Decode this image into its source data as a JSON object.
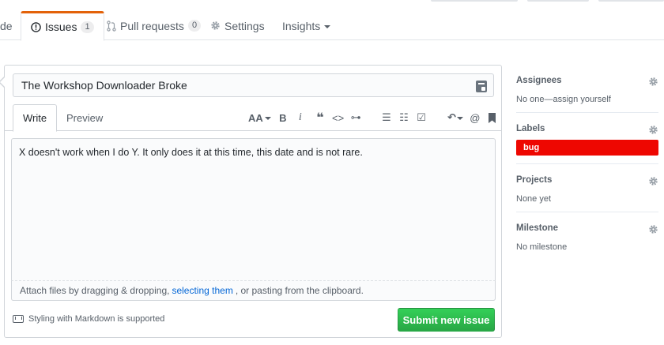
{
  "nav": {
    "code_fragment": "de",
    "issues_label": "Issues",
    "issues_count": "1",
    "pulls_label": "Pull requests",
    "pulls_count": "0",
    "settings_label": "Settings",
    "insights_label": "Insights"
  },
  "form": {
    "title_value": "The Workshop Downloader Broke",
    "write_tab": "Write",
    "preview_tab": "Preview",
    "toolbar": {
      "header": "AA",
      "bold": "B",
      "italic": "i",
      "quote": "❝",
      "code": "<>",
      "link": "⊶",
      "ul": "☰",
      "ol": "☷",
      "tasks": "☑",
      "reply": "↶",
      "mention": "@",
      "bookmark": "🔖"
    },
    "body_text": "X doesn't work when I do Y. It only does it at this time, this date and is not rare.",
    "attach_prefix": "Attach files by dragging & dropping,",
    "attach_link": "selecting them",
    "attach_suffix": ", or pasting from the clipboard.",
    "markdown_note": "Styling with Markdown is supported",
    "submit_label": "Submit new issue"
  },
  "sidebar": {
    "assignees_title": "Assignees",
    "assignees_value": "No one—assign yourself",
    "labels_title": "Labels",
    "label_bug": "bug",
    "projects_title": "Projects",
    "projects_value": "None yet",
    "milestone_title": "Milestone",
    "milestone_value": "No milestone"
  },
  "colors": {
    "accent_tab": "#e36209",
    "submit_green": "#2cbe4e",
    "label_red": "#ee0701",
    "link_blue": "#0366d6"
  },
  "icons": [
    "issue-opened-icon",
    "pull-request-icon",
    "gear-icon",
    "caret-down-icon",
    "markdown-icon",
    "grammarly-icon"
  ]
}
